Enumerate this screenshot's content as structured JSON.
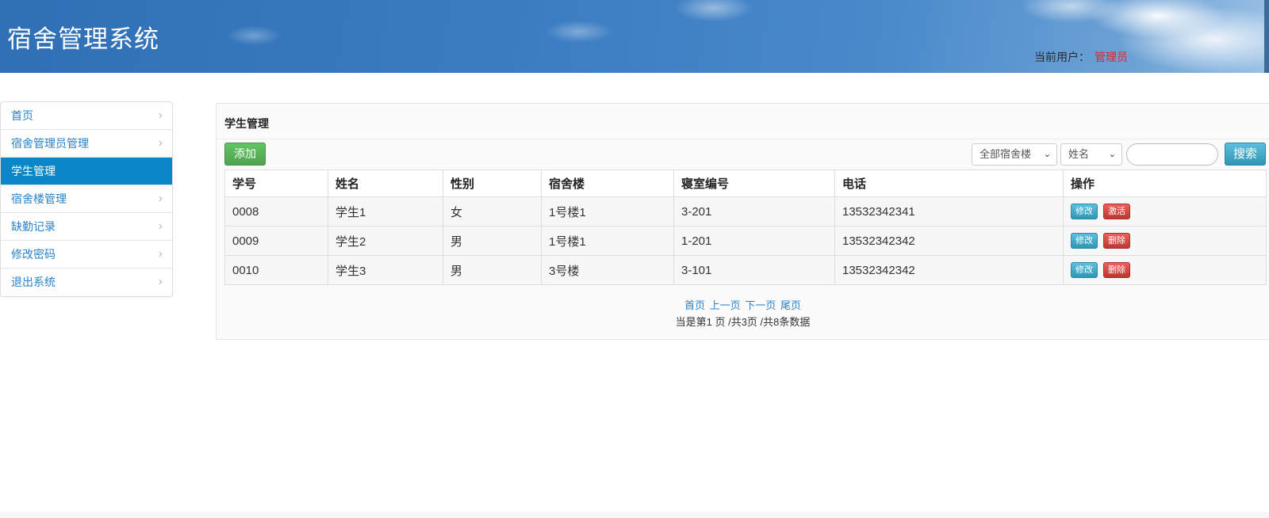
{
  "header": {
    "app_title": "宿舍管理系统",
    "user_label": "当前用户：",
    "user_name": "管理员"
  },
  "sidebar": {
    "items": [
      {
        "label": "首页",
        "active": false
      },
      {
        "label": "宿舍管理员管理",
        "active": false
      },
      {
        "label": "学生管理",
        "active": true
      },
      {
        "label": "宿舍楼管理",
        "active": false
      },
      {
        "label": "缺勤记录",
        "active": false
      },
      {
        "label": "修改密码",
        "active": false
      },
      {
        "label": "退出系统",
        "active": false
      }
    ],
    "chevron_icon": "chevron-right-icon"
  },
  "panel": {
    "title": "学生管理",
    "add_label": "添加",
    "building_filter": {
      "selected": "全部宿舍楼"
    },
    "field_filter": {
      "selected": "姓名"
    },
    "search_value": "",
    "search_label": "搜索"
  },
  "table": {
    "headers": [
      "学号",
      "姓名",
      "性别",
      "宿舍楼",
      "寝室编号",
      "电话",
      "操作"
    ],
    "rows": [
      {
        "cells": [
          "0008",
          "学生1",
          "女",
          "1号楼1",
          "3-201",
          "13532342341"
        ],
        "edit_label": "修改",
        "action_label": "激活"
      },
      {
        "cells": [
          "0009",
          "学生2",
          "男",
          "1号楼1",
          "1-201",
          "13532342342"
        ],
        "edit_label": "修改",
        "action_label": "删除"
      },
      {
        "cells": [
          "0010",
          "学生3",
          "男",
          "3号楼",
          "3-101",
          "13532342342"
        ],
        "edit_label": "修改",
        "action_label": "删除"
      }
    ]
  },
  "pager": {
    "first": "首页",
    "prev": "上一页",
    "next": "下一页",
    "last": "尾页",
    "info": "当是第1 页 /共3页  /共8条数据"
  },
  "colors": {
    "accent": "#0a87c6",
    "link": "#2a82c9",
    "success": "#51a351",
    "info": "#2f96b4",
    "danger": "#bd362f",
    "user_name": "#e5212d"
  }
}
